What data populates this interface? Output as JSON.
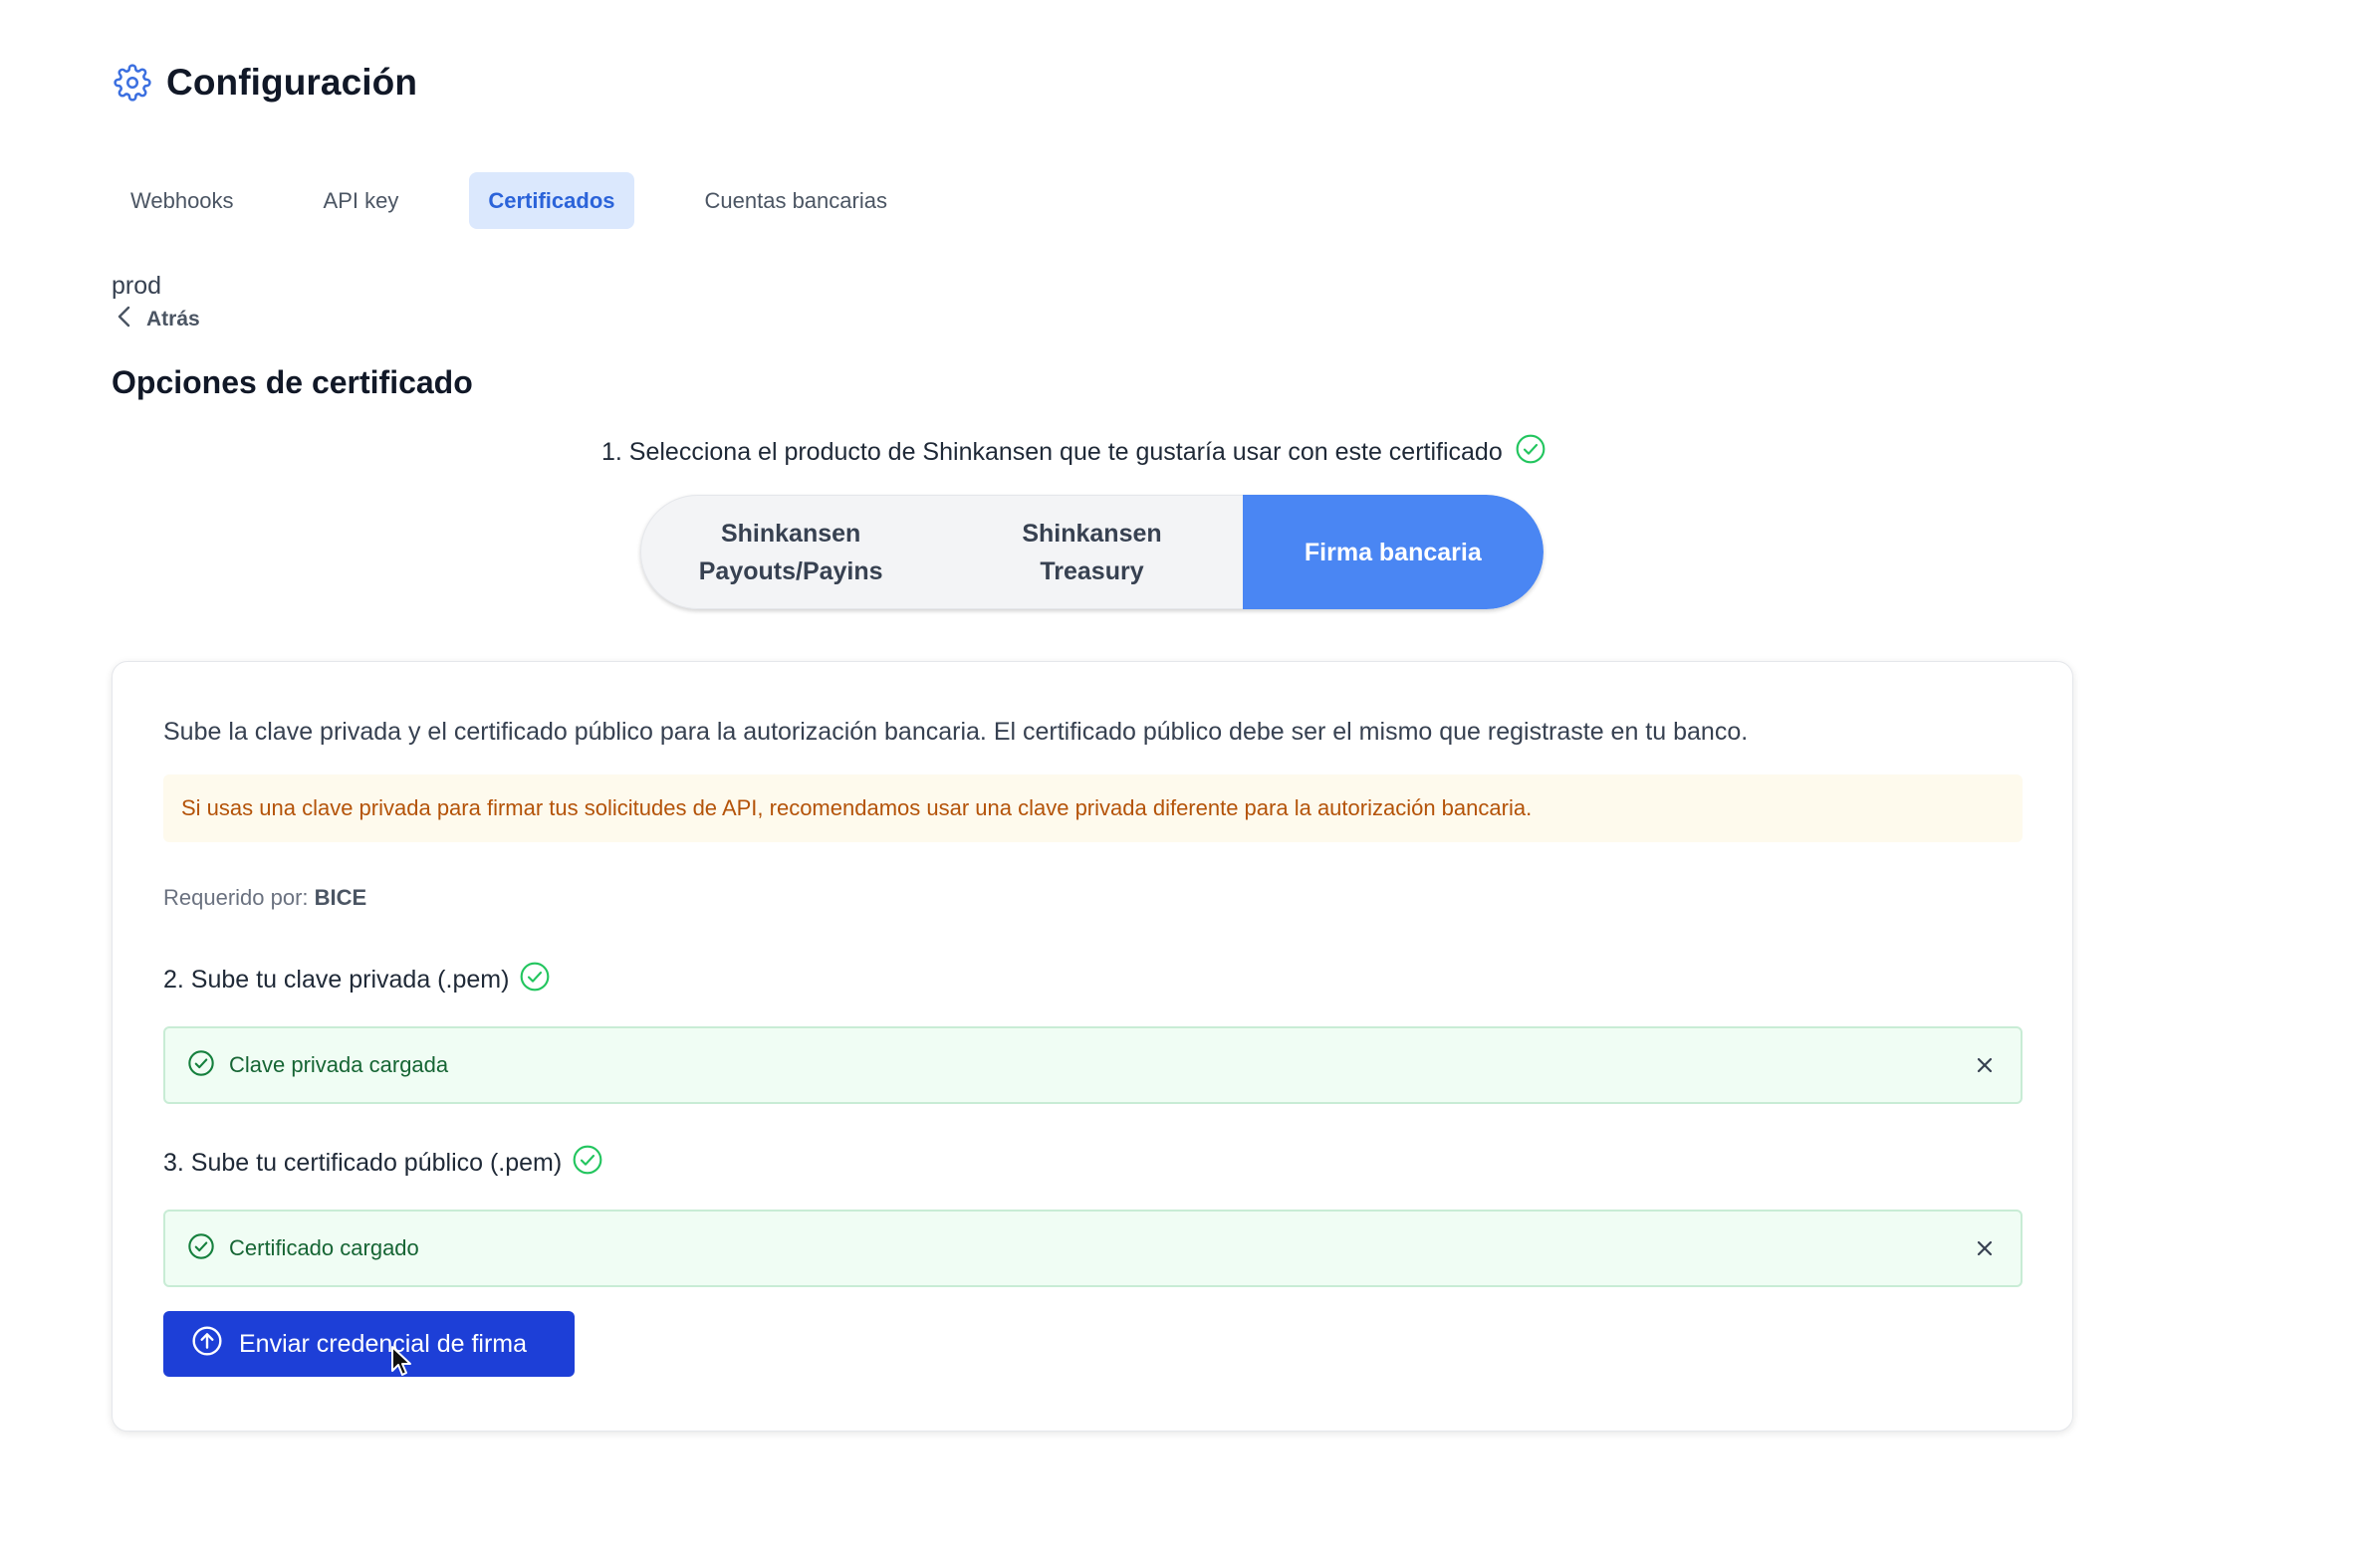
{
  "header": {
    "title": "Configuración",
    "icon": "gear-icon"
  },
  "tabs": [
    {
      "label": "Webhooks",
      "active": false
    },
    {
      "label": "API key",
      "active": false
    },
    {
      "label": "Certificados",
      "active": true
    },
    {
      "label": "Cuentas bancarias",
      "active": false
    }
  ],
  "environment": "prod",
  "back": {
    "label": "Atrás",
    "icon": "chevron-left-icon"
  },
  "section_title": "Opciones de certificado",
  "step1": {
    "label": "1. Selecciona el producto de Shinkansen que te gustaría usar con este certificado",
    "done": true
  },
  "products": [
    {
      "label": "Shinkansen Payouts/Payins",
      "line1": "Shinkansen",
      "line2": "Payouts/Payins",
      "selected": false
    },
    {
      "label": "Shinkansen Treasury",
      "line1": "Shinkansen",
      "line2": "Treasury",
      "selected": false
    },
    {
      "label": "Firma bancaria",
      "line1": "Firma bancaria",
      "line2": "",
      "selected": true
    }
  ],
  "card": {
    "description": "Sube la clave privada y el certificado público para la autorización bancaria. El certificado público debe ser el mismo que registraste en tu banco.",
    "warning": "Si usas una clave privada para firmar tus solicitudes de API, recomendamos usar una clave privada diferente para la autorización bancaria.",
    "required_label": "Requerido por:",
    "required_value": "BICE",
    "step2": {
      "label": "2. Sube tu clave privada (.pem)",
      "done": true,
      "status": "Clave privada cargada"
    },
    "step3": {
      "label": "3. Sube tu certificado público (.pem)",
      "done": true,
      "status": "Certificado cargado"
    },
    "submit_label": "Enviar credencial de firma"
  },
  "colors": {
    "primary": "#1d3fd7",
    "selected_segment": "#4a86f3",
    "tab_active_bg": "#dbe8fd",
    "tab_active_text": "#2b63d9",
    "success": "#22c55e",
    "success_bg": "#f0fdf4",
    "warning_bg": "#fefaed",
    "warning_text": "#b45309"
  }
}
